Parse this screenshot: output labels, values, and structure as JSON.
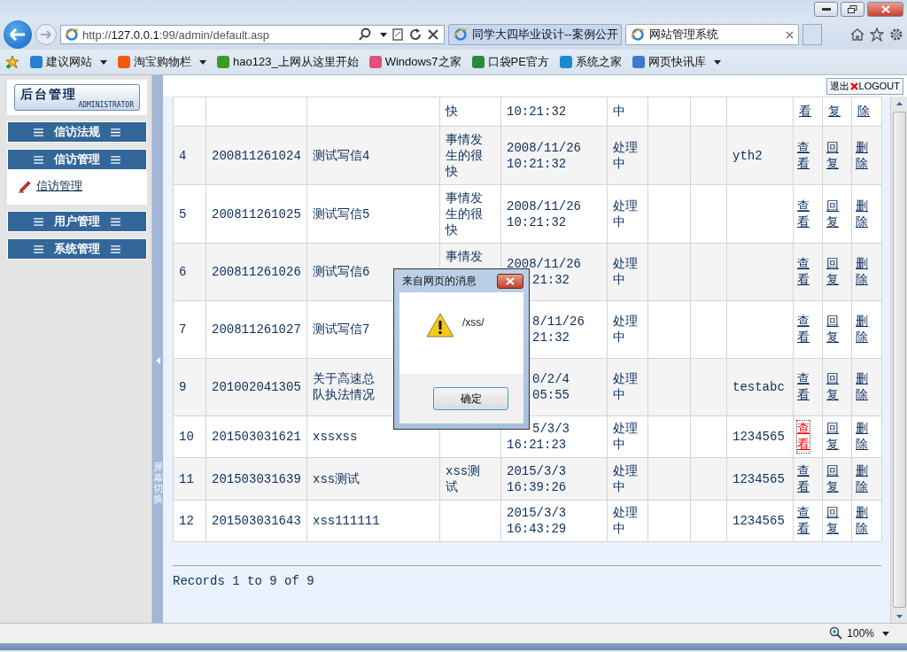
{
  "browser": {
    "url": {
      "scheme": "http://",
      "host": "127.0.0.1",
      "rest": ":99/admin/default.asp"
    },
    "tabs": [
      {
        "title": "同学大四毕业设计--案例公开",
        "selected": false
      },
      {
        "title": "网站管理系统",
        "selected": true
      }
    ],
    "favorites": [
      {
        "label": "建议网站",
        "dropdown": true,
        "color": "#2a7fd4"
      },
      {
        "label": "淘宝购物栏",
        "dropdown": true,
        "color": "#f05a10"
      },
      {
        "label": "hao123_上网从这里开始",
        "dropdown": false,
        "color": "#3a9a2a"
      },
      {
        "label": "Windows7之家",
        "dropdown": false,
        "color": "#e0507a"
      },
      {
        "label": "口袋PE官方",
        "dropdown": false,
        "color": "#2a8a3a"
      },
      {
        "label": "系统之家",
        "dropdown": false,
        "color": "#1a8ad0"
      },
      {
        "label": "网页快讯库",
        "dropdown": true,
        "color": "#3a7ad0"
      }
    ]
  },
  "sidebar": {
    "logo": {
      "title": "后台管理",
      "subtitle": "ADMINISTRATOR"
    },
    "menus": [
      {
        "label": "信访法规",
        "expanded": false
      },
      {
        "label": "信访管理",
        "expanded": true,
        "children": [
          {
            "label": "信访管理"
          }
        ]
      },
      {
        "label": "用户管理",
        "expanded": false
      },
      {
        "label": "系统管理",
        "expanded": false
      }
    ]
  },
  "splitter": {
    "label": "屏幕切换"
  },
  "logout": {
    "label_cn": "退出",
    "label_en": "LOGOUT"
  },
  "table": {
    "rows": [
      {
        "content": "快",
        "date": [
          {
            "text": "10:21:32",
            "covered": false
          }
        ],
        "status": "中",
        "actions": [
          {
            "label": "看",
            "focused": false
          },
          {
            "label": "复",
            "focused": false
          },
          {
            "label": "除",
            "focused": false
          }
        ]
      },
      {
        "index": "4",
        "id": "200811261024",
        "title": "测试写信4",
        "content": "事情发生的很快",
        "date": [
          {
            "text": "2008/11/26",
            "covered": false
          },
          {
            "text": "10:21:32",
            "covered": false
          }
        ],
        "status": "处理中",
        "user": "yth2",
        "actions": [
          {
            "label": "查看",
            "focused": false
          },
          {
            "label": "回复",
            "focused": false
          },
          {
            "label": "删除",
            "focused": false
          }
        ]
      },
      {
        "index": "5",
        "id": "200811261025",
        "title": "测试写信5",
        "content": "事情发生的很快",
        "date": [
          {
            "text": "2008/11/26",
            "covered": false
          },
          {
            "text": "10:21:32",
            "covered": false
          }
        ],
        "status": "处理中",
        "actions": [
          {
            "label": "查看",
            "focused": false
          },
          {
            "label": "回复",
            "focused": false
          },
          {
            "label": "删除",
            "focused": false
          }
        ]
      },
      {
        "index": "6",
        "id": "200811261026",
        "title": "测试写信6",
        "content": "事情发",
        "date": [
          {
            "text": "2008/11/26",
            "covered": false
          },
          {
            "text": "21:32",
            "covered": true
          }
        ],
        "status": "处理中",
        "actions": [
          {
            "label": "查看",
            "focused": false
          },
          {
            "label": "回复",
            "focused": false
          },
          {
            "label": "删除",
            "focused": false
          }
        ]
      },
      {
        "index": "7",
        "id": "200811261027",
        "title": "测试写信7",
        "date": [
          {
            "text": "8/11/26",
            "covered": true
          },
          {
            "text": "21:32",
            "covered": true
          }
        ],
        "status": "处理中",
        "actions": [
          {
            "label": "查看",
            "focused": false
          },
          {
            "label": "回复",
            "focused": false
          },
          {
            "label": "删除",
            "focused": false
          }
        ]
      },
      {
        "index": "9",
        "id": "201002041305",
        "title": [
          "关于高速总",
          "队执法情况"
        ],
        "date": [
          {
            "text": "0/2/4",
            "covered": true
          },
          {
            "text": "05:55",
            "covered": true
          }
        ],
        "status": "处理中",
        "user": "testabc",
        "actions": [
          {
            "label": "查看",
            "focused": false
          },
          {
            "label": "回复",
            "focused": false
          },
          {
            "label": "删除",
            "focused": false
          }
        ]
      },
      {
        "index": "10",
        "id": "201503031621",
        "title": "xssxss",
        "date": [
          {
            "text": "5/3/3",
            "covered": true
          },
          {
            "text": "16:21:23",
            "covered": false
          }
        ],
        "status": "处理中",
        "user": "1234565",
        "actions": [
          {
            "label": "查看",
            "focused": true
          },
          {
            "label": "回复",
            "focused": false
          },
          {
            "label": "删除",
            "focused": false
          }
        ]
      },
      {
        "index": "11",
        "id": "201503031639",
        "title": "xss测试",
        "content": "xss测试",
        "date": [
          {
            "text": "2015/3/3",
            "covered": false
          },
          {
            "text": "16:39:26",
            "covered": false
          }
        ],
        "status": "处理中",
        "user": "1234565",
        "actions": [
          {
            "label": "查看",
            "focused": false
          },
          {
            "label": "回复",
            "focused": false
          },
          {
            "label": "删除",
            "focused": false
          }
        ]
      },
      {
        "index": "12",
        "id": "201503031643",
        "title": "xss111111",
        "date": [
          {
            "text": "2015/3/3",
            "covered": false
          },
          {
            "text": "16:43:29",
            "covered": false
          }
        ],
        "status": "处理中",
        "user": "1234565",
        "actions": [
          {
            "label": "查看",
            "focused": false
          },
          {
            "label": "回复",
            "focused": false
          },
          {
            "label": "删除",
            "focused": false
          }
        ]
      }
    ]
  },
  "pager": "Records 1 to 9 of 9",
  "dialog": {
    "title": "来自网页的消息",
    "message": "/xss/",
    "button": "确定"
  },
  "status_bar": {
    "zoom": "100%"
  }
}
